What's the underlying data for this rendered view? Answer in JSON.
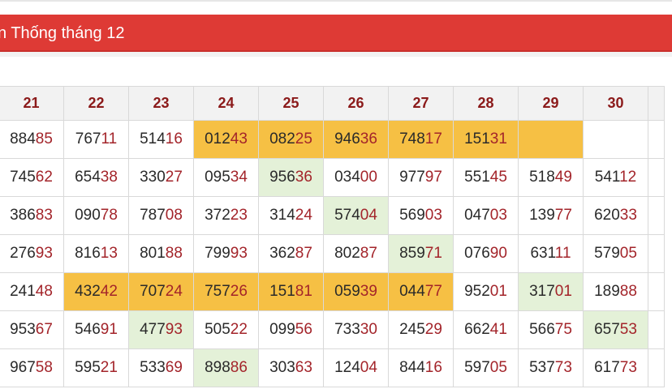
{
  "header": {
    "title": "n Thống tháng 12"
  },
  "table": {
    "columns": [
      "21",
      "22",
      "23",
      "24",
      "25",
      "26",
      "27",
      "28",
      "29",
      "30"
    ],
    "rows": [
      [
        {
          "v": "88485",
          "h": ""
        },
        {
          "v": "76711",
          "h": ""
        },
        {
          "v": "51416",
          "h": ""
        },
        {
          "v": "01243",
          "h": "y"
        },
        {
          "v": "08225",
          "h": "y"
        },
        {
          "v": "94636",
          "h": "y"
        },
        {
          "v": "74817",
          "h": "y"
        },
        {
          "v": "15131",
          "h": "y"
        },
        {
          "v": "",
          "h": "y"
        },
        {
          "v": "",
          "h": ""
        }
      ],
      [
        {
          "v": "74562",
          "h": ""
        },
        {
          "v": "65438",
          "h": ""
        },
        {
          "v": "33027",
          "h": ""
        },
        {
          "v": "09534",
          "h": ""
        },
        {
          "v": "95636",
          "h": "g"
        },
        {
          "v": "03400",
          "h": ""
        },
        {
          "v": "97797",
          "h": ""
        },
        {
          "v": "55145",
          "h": ""
        },
        {
          "v": "51849",
          "h": ""
        },
        {
          "v": "54112",
          "h": ""
        }
      ],
      [
        {
          "v": "38683",
          "h": ""
        },
        {
          "v": "09078",
          "h": ""
        },
        {
          "v": "78708",
          "h": ""
        },
        {
          "v": "37223",
          "h": ""
        },
        {
          "v": "31424",
          "h": ""
        },
        {
          "v": "57404",
          "h": "g"
        },
        {
          "v": "56903",
          "h": ""
        },
        {
          "v": "04703",
          "h": ""
        },
        {
          "v": "13977",
          "h": ""
        },
        {
          "v": "62033",
          "h": ""
        }
      ],
      [
        {
          "v": "27693",
          "h": ""
        },
        {
          "v": "81613",
          "h": ""
        },
        {
          "v": "80188",
          "h": ""
        },
        {
          "v": "79993",
          "h": ""
        },
        {
          "v": "36287",
          "h": ""
        },
        {
          "v": "80287",
          "h": ""
        },
        {
          "v": "85971",
          "h": "g"
        },
        {
          "v": "07690",
          "h": ""
        },
        {
          "v": "63111",
          "h": ""
        },
        {
          "v": "57905",
          "h": ""
        }
      ],
      [
        {
          "v": "24148",
          "h": ""
        },
        {
          "v": "43242",
          "h": "y"
        },
        {
          "v": "70724",
          "h": "y"
        },
        {
          "v": "75726",
          "h": "y"
        },
        {
          "v": "15181",
          "h": "y"
        },
        {
          "v": "05939",
          "h": "y"
        },
        {
          "v": "04477",
          "h": "y"
        },
        {
          "v": "95201",
          "h": ""
        },
        {
          "v": "31701",
          "h": "g"
        },
        {
          "v": "18988",
          "h": ""
        }
      ],
      [
        {
          "v": "95367",
          "h": ""
        },
        {
          "v": "54691",
          "h": ""
        },
        {
          "v": "47793",
          "h": "g"
        },
        {
          "v": "50522",
          "h": ""
        },
        {
          "v": "09956",
          "h": ""
        },
        {
          "v": "73330",
          "h": ""
        },
        {
          "v": "24529",
          "h": ""
        },
        {
          "v": "66241",
          "h": ""
        },
        {
          "v": "56675",
          "h": ""
        },
        {
          "v": "65753",
          "h": "g"
        }
      ],
      [
        {
          "v": "96758",
          "h": ""
        },
        {
          "v": "59521",
          "h": ""
        },
        {
          "v": "53369",
          "h": ""
        },
        {
          "v": "89886",
          "h": "g"
        },
        {
          "v": "30363",
          "h": ""
        },
        {
          "v": "12404",
          "h": ""
        },
        {
          "v": "84416",
          "h": ""
        },
        {
          "v": "59705",
          "h": ""
        },
        {
          "v": "53773",
          "h": ""
        },
        {
          "v": "61773",
          "h": ""
        }
      ]
    ]
  },
  "colors": {
    "banner": "#de3a35",
    "highlight_yellow": "#f6c044",
    "highlight_green": "#e4f1d8",
    "digit_tail": "#a3242a"
  }
}
